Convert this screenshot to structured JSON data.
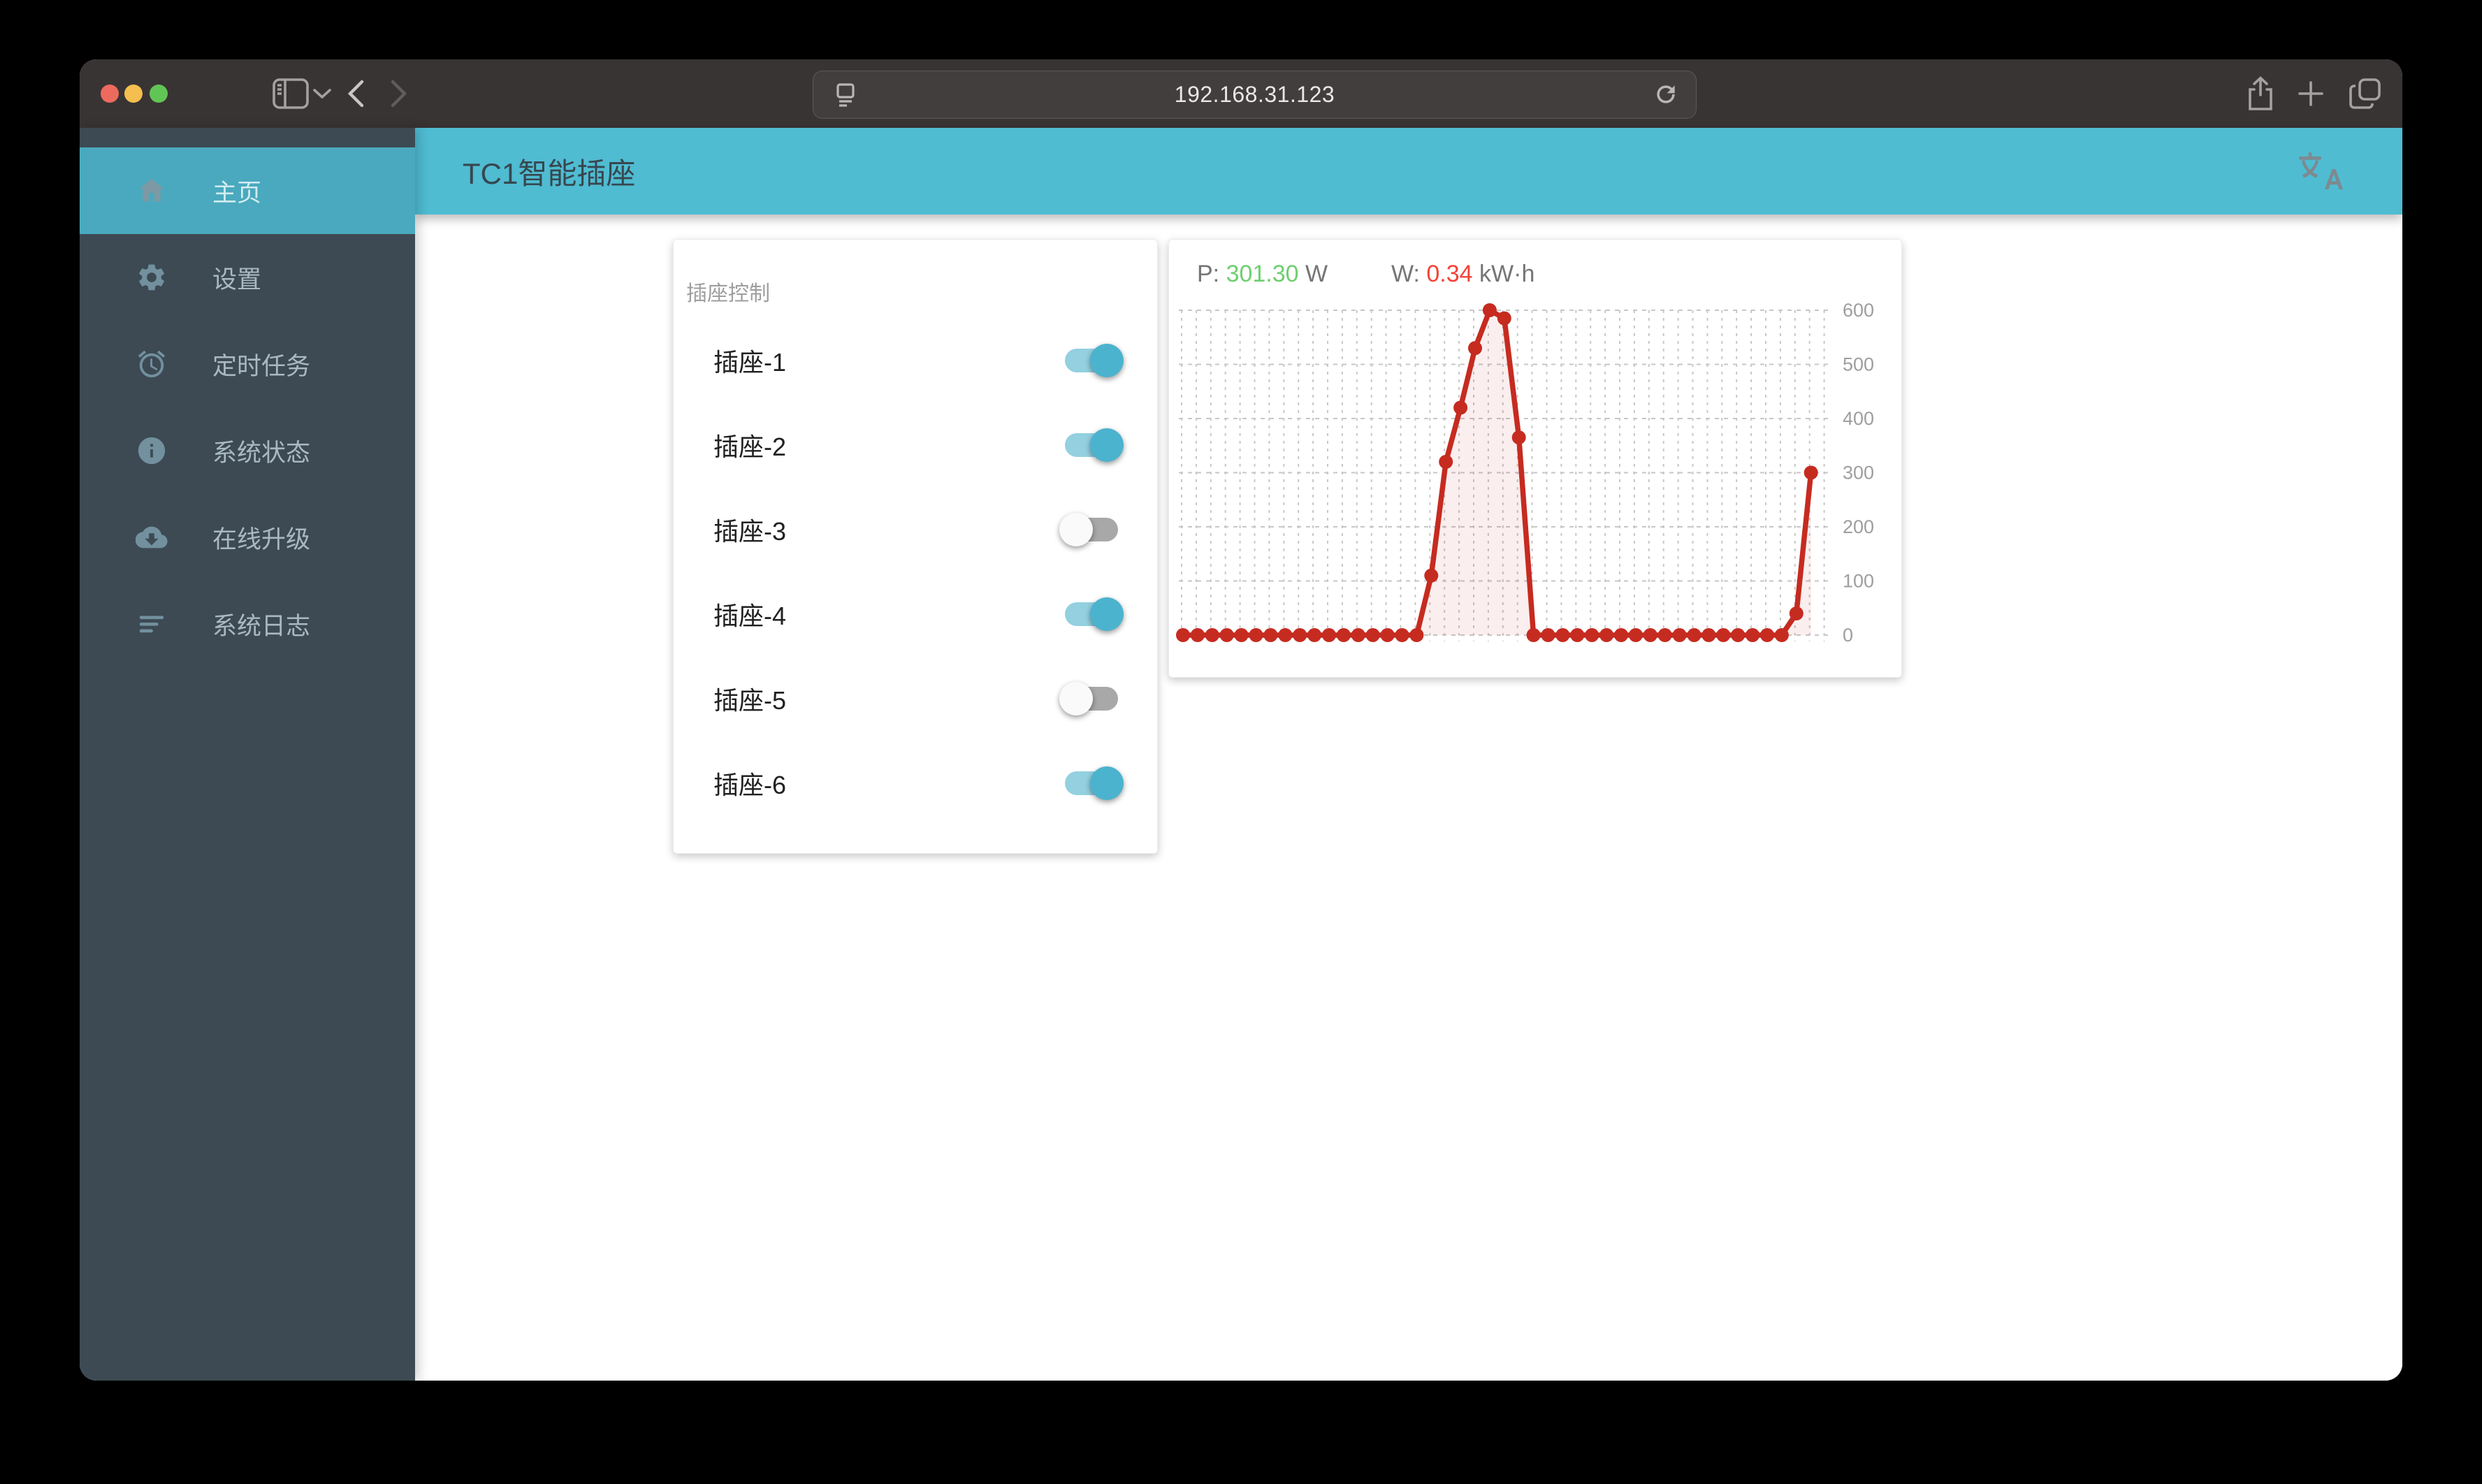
{
  "browser": {
    "url": "192.168.31.123",
    "traffic_lights": {
      "close": "#ed6a5e",
      "minimize": "#f4bf4f",
      "zoom": "#61c555"
    },
    "icons": [
      "sidebar-toggle-icon",
      "chevron-down-icon",
      "back-icon",
      "forward-icon",
      "page-icon",
      "reload-icon",
      "share-icon",
      "new-tab-icon",
      "tab-overview-icon"
    ]
  },
  "app": {
    "header": {
      "title": "TC1智能插座",
      "accent": "#4fbcd2",
      "icon": "translate-icon"
    },
    "sidebar": {
      "background": "#3d4a53",
      "active_background": "#4aa9be",
      "items": [
        {
          "label": "主页",
          "icon": "home-icon",
          "active": true
        },
        {
          "label": "设置",
          "icon": "gear-icon",
          "active": false
        },
        {
          "label": "定时任务",
          "icon": "alarm-clock-icon",
          "active": false
        },
        {
          "label": "系统状态",
          "icon": "info-icon",
          "active": false
        },
        {
          "label": "在线升级",
          "icon": "cloud-download-icon",
          "active": false
        },
        {
          "label": "系统日志",
          "icon": "log-lines-icon",
          "active": false
        }
      ]
    },
    "socket_card": {
      "title": "插座控制",
      "toggle_on_color": "#4cb3ce",
      "sockets": [
        {
          "label": "插座-1",
          "on": true
        },
        {
          "label": "插座-2",
          "on": true
        },
        {
          "label": "插座-3",
          "on": false
        },
        {
          "label": "插座-4",
          "on": true
        },
        {
          "label": "插座-5",
          "on": false
        },
        {
          "label": "插座-6",
          "on": true
        }
      ]
    },
    "chart_card": {
      "power_label": "P:",
      "power_value": "301.30",
      "power_unit": "W",
      "energy_label": "W:",
      "energy_value": "0.34",
      "energy_unit": "kW·h"
    }
  },
  "chart_data": {
    "type": "line",
    "title": "",
    "xlabel": "",
    "ylabel": "",
    "x_tick_labels_visible": false,
    "y_ticks": [
      600,
      500,
      400,
      300,
      200,
      100,
      0
    ],
    "ylim": [
      0,
      600
    ],
    "grid": "dashed-both-axes",
    "legend_position": "none",
    "line_color": "#c62b20",
    "fill_color": "rgba(197,42,32,0.08)",
    "marker": "circle",
    "series": [
      {
        "name": "power_w",
        "values": [
          0,
          0,
          0,
          0,
          0,
          0,
          0,
          0,
          0,
          0,
          0,
          0,
          0,
          0,
          0,
          0,
          0,
          110,
          320,
          420,
          530,
          600,
          585,
          365,
          0,
          0,
          0,
          0,
          0,
          0,
          0,
          0,
          0,
          0,
          0,
          0,
          0,
          0,
          0,
          0,
          0,
          0,
          40,
          300
        ]
      }
    ]
  }
}
